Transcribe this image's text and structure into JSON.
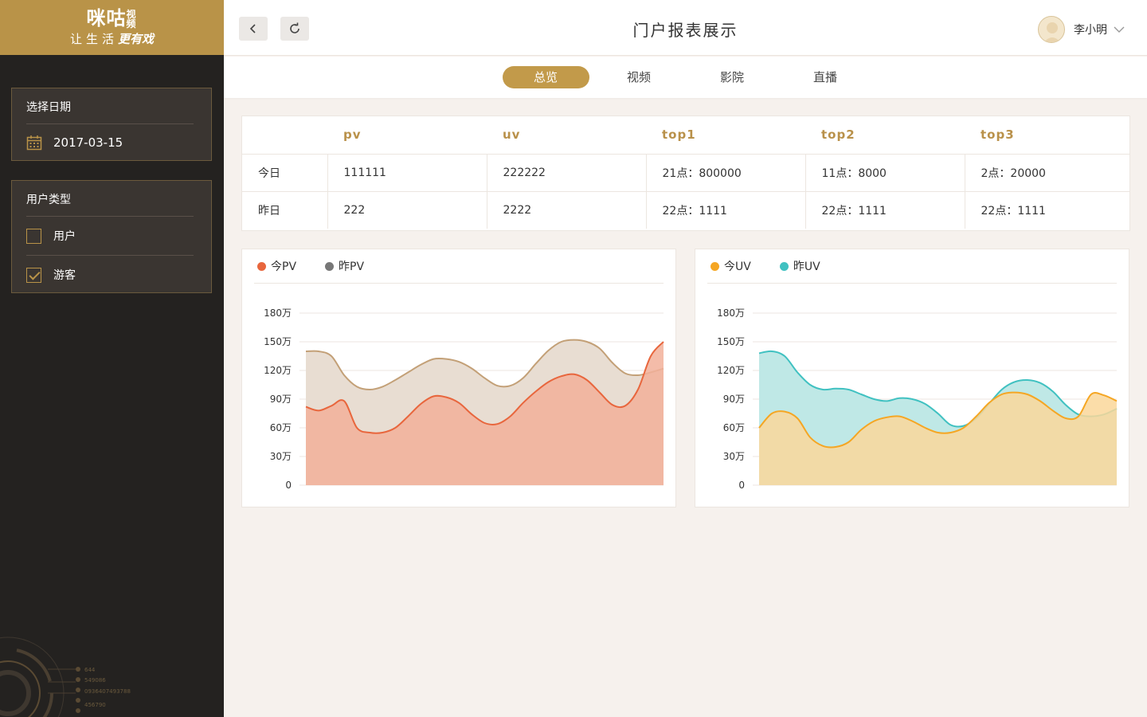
{
  "logo": {
    "brand": "咪咕",
    "brand_small": "视频",
    "slogan": "让生活",
    "slogan_em": "更有戏"
  },
  "sidebar": {
    "date_panel": {
      "title": "选择日期",
      "date": "2017-03-15"
    },
    "user_type_panel": {
      "title": "用户类型",
      "options": [
        {
          "label": "用户",
          "checked": false
        },
        {
          "label": "游客",
          "checked": true
        }
      ]
    },
    "deco_text": [
      "644",
      "549086",
      "0936407493788",
      "456790"
    ]
  },
  "header": {
    "title": "门户报表展示",
    "user_name": "李小明"
  },
  "tabs": [
    {
      "label": "总览",
      "active": true
    },
    {
      "label": "视频",
      "active": false
    },
    {
      "label": "影院",
      "active": false
    },
    {
      "label": "直播",
      "active": false
    }
  ],
  "table": {
    "headers": [
      "",
      "pv",
      "uv",
      "top1",
      "top2",
      "top3"
    ],
    "rows": [
      [
        "今日",
        "111111",
        "222222",
        "21点：800000",
        "11点：8000",
        "2点：20000"
      ],
      [
        "昨日",
        "222",
        "2222",
        "22点：1111",
        "22点：1111",
        "22点：1111"
      ]
    ]
  },
  "colors": {
    "accent": "#c29a4a",
    "sidebar": "#242220"
  },
  "chart_data": [
    {
      "type": "area",
      "title": "",
      "y_ticks": [
        "0",
        "30万",
        "60万",
        "90万",
        "120万",
        "150万",
        "180万"
      ],
      "ylim": [
        0,
        180
      ],
      "grid": true,
      "legend_position": "top-left",
      "series": [
        {
          "name": "昨PV",
          "legend_color": "#777777",
          "line_color": "#c3a077",
          "fill": "#e8ddd2",
          "values": [
            140,
            140,
            135,
            115,
            103,
            100,
            103,
            110,
            118,
            126,
            132,
            132,
            129,
            122,
            112,
            104,
            104,
            112,
            127,
            141,
            150,
            152,
            150,
            143,
            128,
            117,
            115,
            118,
            122
          ]
        },
        {
          "name": "今PV",
          "legend_color": "#e8663d",
          "line_color": "#e8663d",
          "fill": "#f2b09a",
          "values": [
            82,
            78,
            83,
            88,
            60,
            55,
            55,
            60,
            72,
            85,
            93,
            92,
            86,
            74,
            65,
            64,
            72,
            86,
            98,
            108,
            114,
            116,
            110,
            97,
            84,
            83,
            100,
            135,
            150
          ]
        }
      ]
    },
    {
      "type": "area",
      "title": "",
      "y_ticks": [
        "0",
        "30万",
        "60万",
        "90万",
        "120万",
        "150万",
        "180万"
      ],
      "ylim": [
        0,
        180
      ],
      "grid": true,
      "legend_position": "top-left",
      "series": [
        {
          "name": "昨UV",
          "legend_color": "#40c1c1",
          "line_color": "#40c1c1",
          "fill": "#bfe8e6",
          "values": [
            138,
            140,
            135,
            118,
            105,
            100,
            101,
            100,
            95,
            90,
            88,
            91,
            90,
            85,
            75,
            63,
            62,
            70,
            85,
            100,
            108,
            110,
            107,
            98,
            84,
            74,
            72,
            74,
            80
          ]
        },
        {
          "name": "今UV",
          "legend_color": "#f5a623",
          "line_color": "#f5a623",
          "fill": "#fad79a",
          "values": [
            60,
            75,
            77,
            70,
            50,
            41,
            40,
            45,
            58,
            67,
            71,
            72,
            67,
            60,
            55,
            55,
            60,
            72,
            86,
            95,
            97,
            95,
            88,
            78,
            70,
            72,
            95,
            94,
            88
          ]
        }
      ]
    }
  ]
}
